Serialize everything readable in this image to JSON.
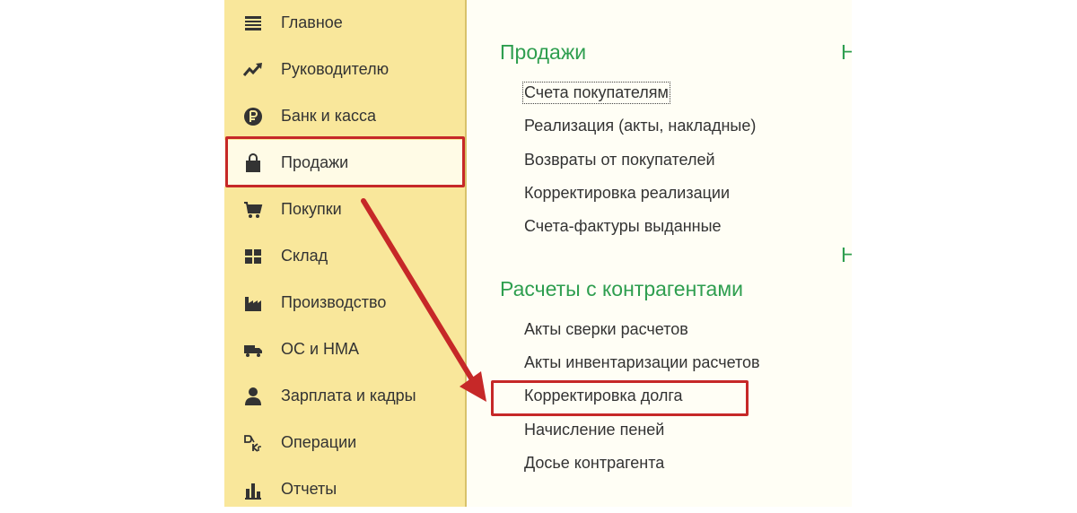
{
  "sidebar": {
    "items": [
      {
        "label": "Главное",
        "icon": "list-lines-icon"
      },
      {
        "label": "Руководителю",
        "icon": "trend-line-icon"
      },
      {
        "label": "Банк и касса",
        "icon": "ruble-coin-icon"
      },
      {
        "label": "Продажи",
        "icon": "shopping-bag-icon",
        "active": true
      },
      {
        "label": "Покупки",
        "icon": "shopping-cart-icon"
      },
      {
        "label": "Склад",
        "icon": "warehouse-grid-icon"
      },
      {
        "label": "Производство",
        "icon": "factory-icon"
      },
      {
        "label": "ОС и НМА",
        "icon": "truck-icon"
      },
      {
        "label": "Зарплата и кадры",
        "icon": "person-icon"
      },
      {
        "label": "Операции",
        "icon": "debit-credit-icon"
      },
      {
        "label": "Отчеты",
        "icon": "bar-chart-icon"
      }
    ]
  },
  "content": {
    "sales": {
      "title": "Продажи",
      "links": [
        "Счета покупателям",
        "Реализация (акты, накладные)",
        "Возвраты от покупателей",
        "Корректировка реализации",
        "Счета-фактуры выданные"
      ]
    },
    "settlements": {
      "title": "Расчеты с контрагентами",
      "links": [
        "Акты сверки расчетов",
        "Акты инвентаризации расчетов",
        "Корректировка долга",
        "Начисление пеней",
        "Досье контрагента"
      ]
    },
    "partial_titles": [
      "Н",
      "Н"
    ]
  },
  "colors": {
    "sidebar_bg": "#f9e79b",
    "content_bg": "#fffef5",
    "section_title": "#2e9e4f",
    "annotation": "#c62828"
  }
}
